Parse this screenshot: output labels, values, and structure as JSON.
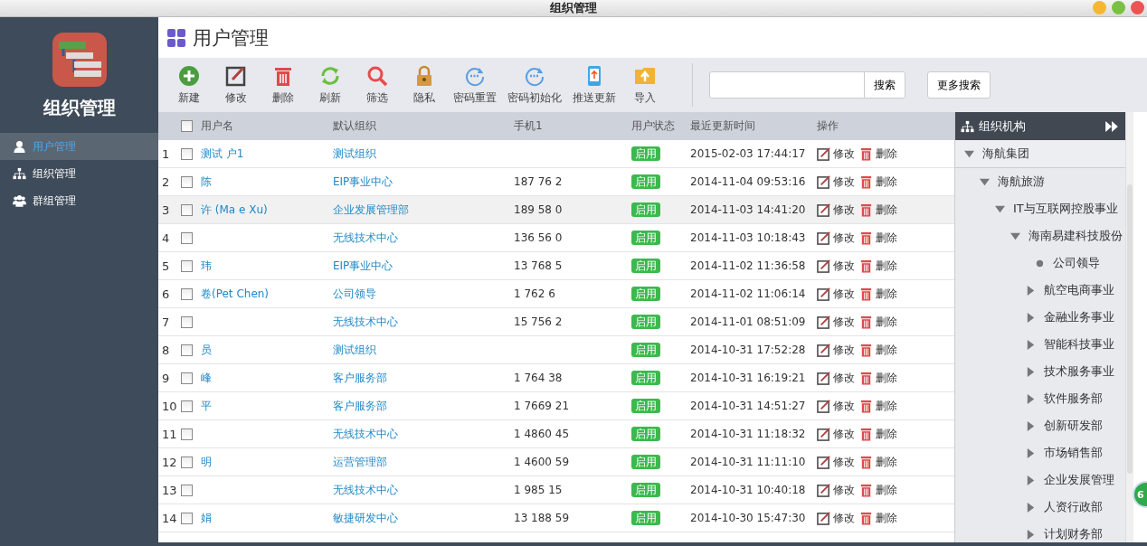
{
  "window": {
    "title": "组织管理"
  },
  "sidebar": {
    "app_name": "组织管理",
    "items": [
      {
        "label": "用户管理",
        "kind": "user",
        "selected": true
      },
      {
        "label": "组织管理",
        "kind": "org",
        "selected": false
      },
      {
        "label": "群组管理",
        "kind": "group",
        "selected": false
      }
    ]
  },
  "page_title": "用户管理",
  "toolbar": [
    {
      "label": "新建",
      "kind": "add"
    },
    {
      "label": "修改",
      "kind": "edit"
    },
    {
      "label": "删除",
      "kind": "delete"
    },
    {
      "label": "刷新",
      "kind": "refresh"
    },
    {
      "label": "筛选",
      "kind": "search"
    },
    {
      "label": "隐私",
      "kind": "lock"
    },
    {
      "label": "密码重置",
      "kind": "reset"
    },
    {
      "label": "密码初始化",
      "kind": "reset"
    },
    {
      "label": "推送更新",
      "kind": "push"
    },
    {
      "label": "导入",
      "kind": "import"
    }
  ],
  "search": {
    "button": "搜索",
    "more_button": "更多搜索"
  },
  "table": {
    "all_checked": false,
    "columns": [
      "用户名",
      "默认组织",
      "手机1",
      "用户状态",
      "最近更新时间",
      "操作"
    ],
    "rows": [
      {
        "index": "1",
        "checked": false,
        "selected": false,
        "name": "测试 户1",
        "org": "测试组织",
        "status": "启用",
        "updated": "2015-02-03 17:44:17",
        "edit": "修改",
        "delete": "删除"
      },
      {
        "index": "2",
        "checked": false,
        "selected": false,
        "name": "陈",
        "org": "EIP事业中心",
        "phone": "187 76 2",
        "status": "启用",
        "updated": "2014-11-04 09:53:16",
        "edit": "修改",
        "delete": "删除"
      },
      {
        "index": "3",
        "checked": false,
        "selected": true,
        "name": "许 (Ma e Xu)",
        "org": "企业发展管理部",
        "phone": "189 58 0",
        "status": "启用",
        "updated": "2014-11-03 14:41:20",
        "edit": "修改",
        "delete": "删除"
      },
      {
        "index": "4",
        "checked": false,
        "selected": false,
        "org": "无线技术中心",
        "phone": "136 56 0",
        "status": "启用",
        "updated": "2014-11-03 10:18:43",
        "edit": "修改",
        "delete": "删除"
      },
      {
        "index": "5",
        "checked": false,
        "selected": false,
        "name": "玮",
        "org": "EIP事业中心",
        "phone": "13 768 5",
        "status": "启用",
        "updated": "2014-11-02 11:36:58",
        "edit": "修改",
        "delete": "删除"
      },
      {
        "index": "6",
        "checked": false,
        "selected": false,
        "name": "卷(Pet Chen)",
        "org": "公司领导",
        "phone": "1 762 6",
        "status": "启用",
        "updated": "2014-11-02 11:06:14",
        "edit": "修改",
        "delete": "删除"
      },
      {
        "index": "7",
        "checked": false,
        "selected": false,
        "org": "无线技术中心",
        "phone": "15 756 2",
        "status": "启用",
        "updated": "2014-11-01 08:51:09",
        "edit": "修改",
        "delete": "删除"
      },
      {
        "index": "8",
        "checked": false,
        "selected": false,
        "name": "员",
        "org": "测试组织",
        "status": "启用",
        "updated": "2014-10-31 17:52:28",
        "edit": "修改",
        "delete": "删除"
      },
      {
        "index": "9",
        "checked": false,
        "selected": false,
        "name": "峰",
        "org": "客户服务部",
        "phone": "1 764 38",
        "status": "启用",
        "updated": "2014-10-31 16:19:21",
        "edit": "修改",
        "delete": "删除"
      },
      {
        "index": "10",
        "checked": false,
        "selected": false,
        "name": "平",
        "org": "客户服务部",
        "phone": "1 7669 21",
        "status": "启用",
        "updated": "2014-10-31 14:51:27",
        "edit": "修改",
        "delete": "删除"
      },
      {
        "index": "11",
        "checked": false,
        "selected": false,
        "org": "无线技术中心",
        "phone": "1 4860 45",
        "status": "启用",
        "updated": "2014-10-31 11:18:32",
        "edit": "修改",
        "delete": "删除"
      },
      {
        "index": "12",
        "checked": false,
        "selected": false,
        "name": "明",
        "org": "运营管理部",
        "phone": "1 4600 59",
        "status": "启用",
        "updated": "2014-10-31 11:11:10",
        "edit": "修改",
        "delete": "删除"
      },
      {
        "index": "13",
        "checked": false,
        "selected": false,
        "org": "无线技术中心",
        "phone": "1 985 15",
        "status": "启用",
        "updated": "2014-10-31 10:40:18",
        "edit": "修改",
        "delete": "删除"
      },
      {
        "index": "14",
        "checked": false,
        "selected": false,
        "name": "娟",
        "org": "敏捷研发中心",
        "phone": "13 188 59",
        "status": "启用",
        "updated": "2014-10-30 15:47:30",
        "edit": "修改",
        "delete": "删除"
      }
    ]
  },
  "org_panel": {
    "title": "组织机构",
    "tree": [
      {
        "label": "海航集团",
        "kind": "folder",
        "expanded": true,
        "children": [
          {
            "label": "海航旅游",
            "kind": "folder",
            "expanded": true,
            "children": [
              {
                "label": "IT与互联网控股事业",
                "kind": "folder",
                "expanded": true,
                "children": [
                  {
                    "label": "海南易建科技股份",
                    "kind": "folder",
                    "expanded": true,
                    "children": [
                      {
                        "label": "公司领导",
                        "kind": "leaf"
                      },
                      {
                        "label": "航空电商事业",
                        "kind": "folder",
                        "expanded": false
                      },
                      {
                        "label": "金融业务事业",
                        "kind": "folder",
                        "expanded": false
                      },
                      {
                        "label": "智能科技事业",
                        "kind": "folder",
                        "expanded": false
                      },
                      {
                        "label": "技术服务事业",
                        "kind": "folder",
                        "expanded": false
                      },
                      {
                        "label": "软件服务部",
                        "kind": "folder",
                        "expanded": false
                      },
                      {
                        "label": "创新研发部",
                        "kind": "folder",
                        "expanded": false
                      },
                      {
                        "label": "市场销售部",
                        "kind": "folder",
                        "expanded": false
                      },
                      {
                        "label": "企业发展管理",
                        "kind": "folder",
                        "expanded": false
                      },
                      {
                        "label": "人资行政部",
                        "kind": "folder",
                        "expanded": false
                      },
                      {
                        "label": "计划财务部",
                        "kind": "folder",
                        "expanded": false
                      }
                    ]
                  }
                ]
              }
            ]
          }
        ]
      }
    ]
  },
  "badge": "6"
}
